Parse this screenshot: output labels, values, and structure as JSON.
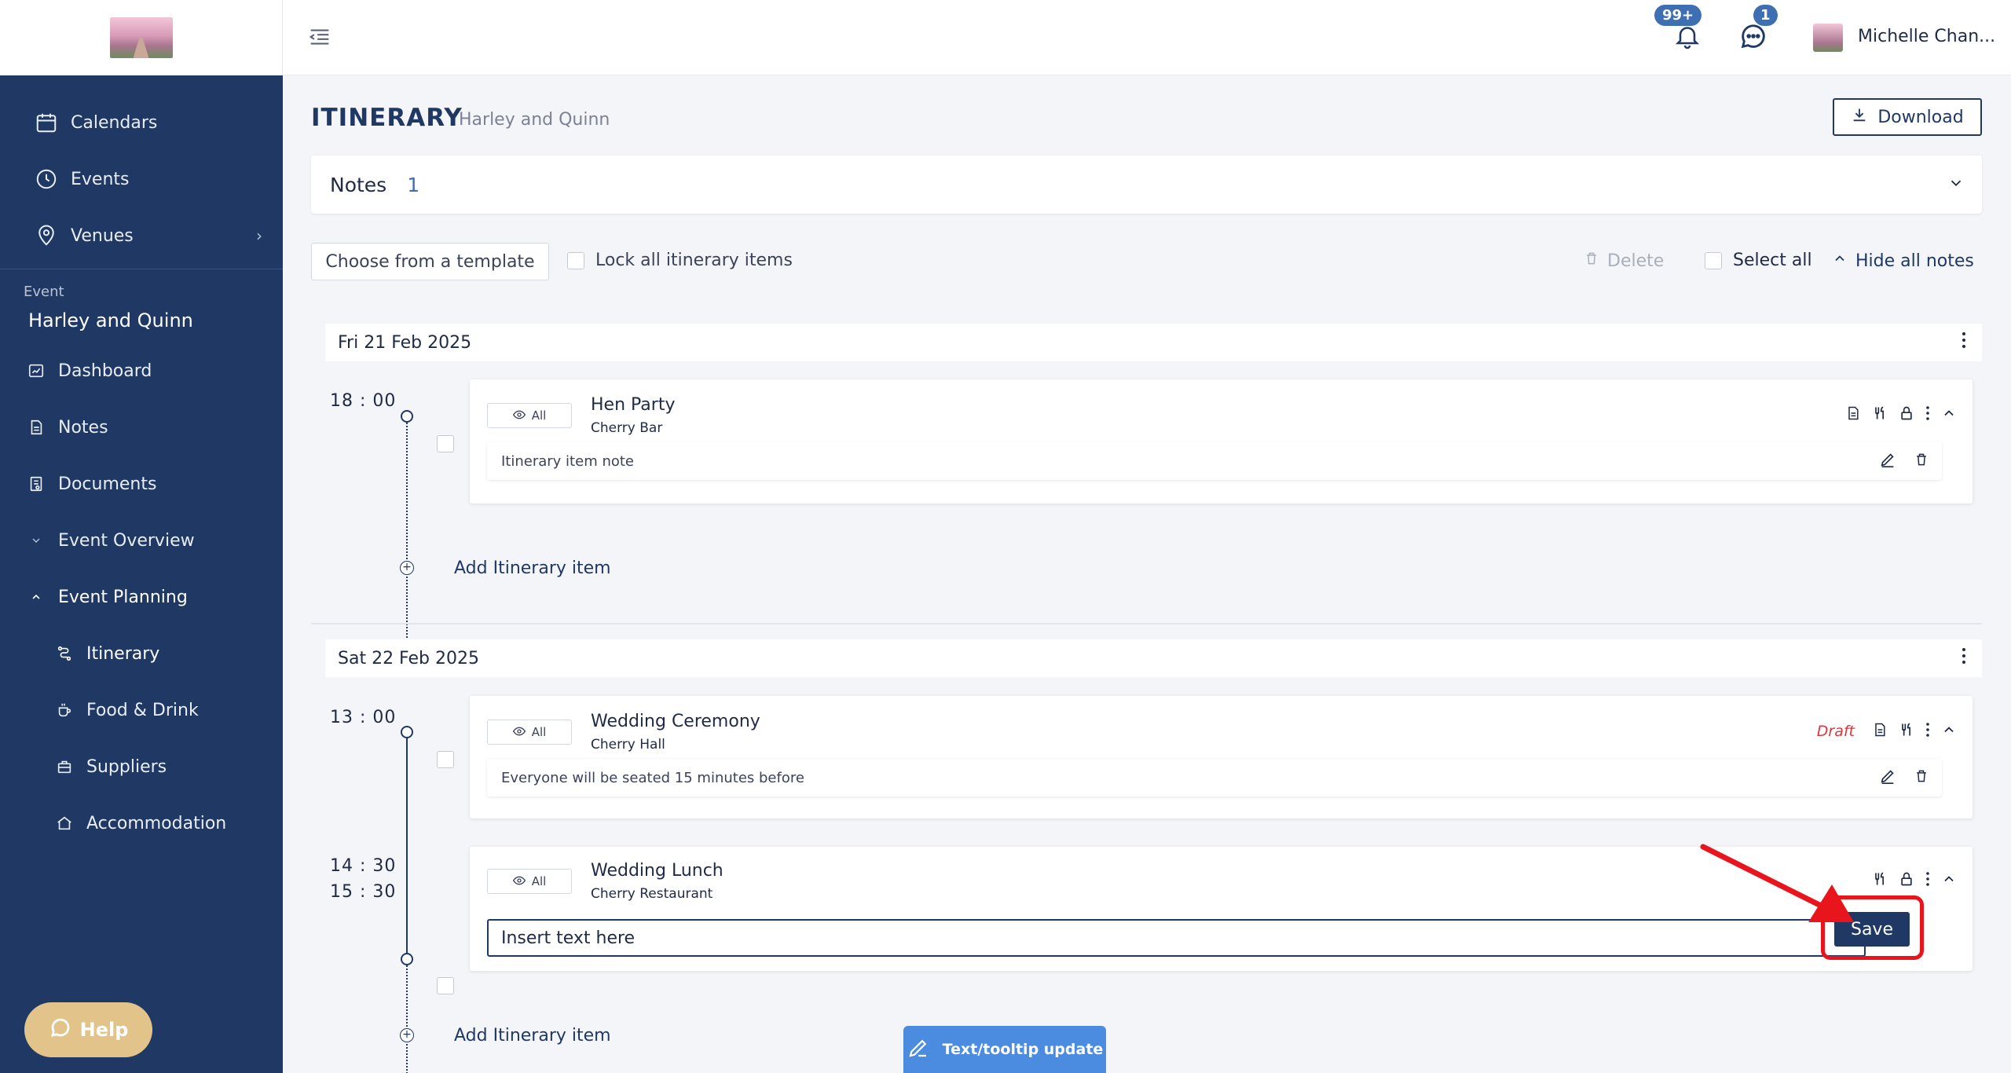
{
  "sidebar": {
    "nav": [
      {
        "label": "Calendars",
        "icon": "calendar-icon"
      },
      {
        "label": "Events",
        "icon": "clock-icon"
      },
      {
        "label": "Venues",
        "icon": "location-pin-icon"
      }
    ],
    "event_label": "Event",
    "event_name": "Harley and Quinn",
    "event_items": [
      {
        "label": "Dashboard"
      },
      {
        "label": "Notes"
      },
      {
        "label": "Documents"
      },
      {
        "label": "Event Overview"
      },
      {
        "label": "Event Planning"
      }
    ],
    "planning_items": [
      {
        "label": "Itinerary"
      },
      {
        "label": "Food & Drink"
      },
      {
        "label": "Suppliers"
      },
      {
        "label": "Accommodation"
      }
    ],
    "help_label": "Help"
  },
  "topbar": {
    "notifications_badge": "99+",
    "messages_badge": "1",
    "user_name": "Michelle Chan..."
  },
  "page": {
    "title": "ITINERARY",
    "subtitle": "Harley and Quinn",
    "download_label": "Download"
  },
  "notes": {
    "label": "Notes",
    "count": "1"
  },
  "toolbar": {
    "template_label": "Choose from a template",
    "lock_all_label": "Lock all itinerary items",
    "delete_label": "Delete",
    "select_all_label": "Select all",
    "hide_notes_label": "Hide all notes"
  },
  "days": [
    {
      "date": "Fri 21 Feb 2025",
      "items": [
        {
          "start": "18 : 00",
          "visibility": "All",
          "title": "Hen Party",
          "venue": "Cherry Bar",
          "note": "Itinerary item note"
        }
      ],
      "add_label": "Add Itinerary item"
    },
    {
      "date": "Sat 22 Feb 2025",
      "items": [
        {
          "start": "13 : 00",
          "visibility": "All",
          "title": "Wedding Ceremony",
          "venue": "Cherry Hall",
          "status": "Draft",
          "note": "Everyone will be seated 15 minutes before"
        },
        {
          "start": "14 : 30",
          "end": "15 : 30",
          "visibility": "All",
          "title": "Wedding Lunch",
          "venue": "Cherry Restaurant",
          "note_placeholder": "Insert text here",
          "save_label": "Save"
        }
      ],
      "add_label": "Add Itinerary item"
    }
  ],
  "tooltip_update_label": "Text/tooltip update",
  "colors": {
    "sidebar": "#1f3864",
    "accent": "#3e6fb3",
    "draft": "#e0343a",
    "highlight": "#e8161c",
    "help": "#e2c48a",
    "tooltip": "#4b8be0"
  }
}
